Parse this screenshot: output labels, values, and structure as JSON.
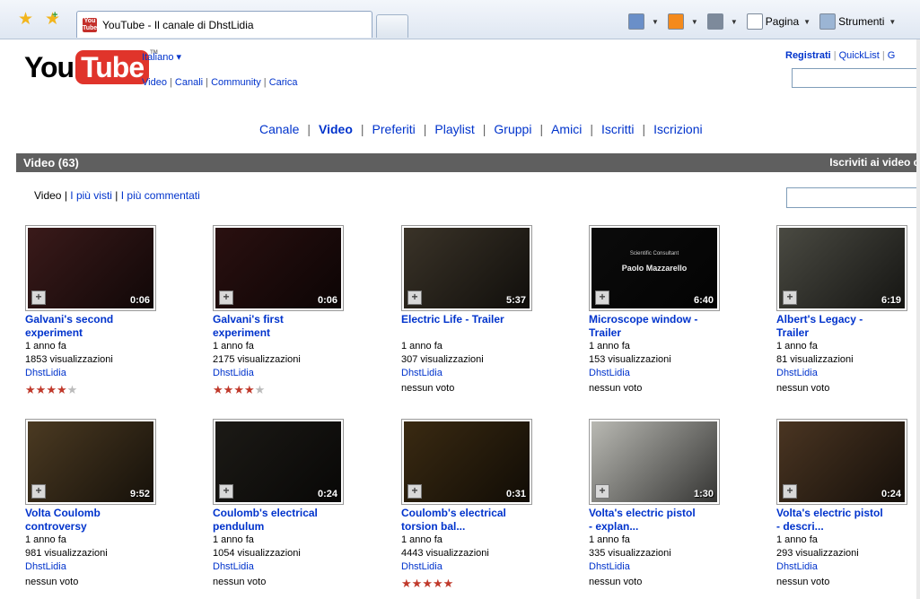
{
  "browser": {
    "tab_title": "YouTube - Il canale di DhstLidia",
    "favicon_text": "You Tube",
    "tools": [
      {
        "icon": "home-icon",
        "color": "#6a8fc8",
        "label": ""
      },
      {
        "icon": "rss-icon",
        "color": "#f48a1c",
        "label": ""
      },
      {
        "icon": "print-icon",
        "color": "#7d8a9b",
        "label": ""
      },
      {
        "icon": "page-icon",
        "color": "#ffffff",
        "label": "Pagina"
      },
      {
        "icon": "gear-icon",
        "color": "#9bb5d4",
        "label": "Strumenti"
      }
    ]
  },
  "header": {
    "logo_you": "You",
    "logo_tube": "Tube",
    "logo_tm": "TM",
    "language": "Italiano ▾",
    "top_links": [
      "Video",
      "Canali",
      "Community",
      "Carica"
    ],
    "register": "Registrati",
    "quicklist": "QuickList",
    "cut_link": "G"
  },
  "channel_nav": {
    "items": [
      "Canale",
      "Video",
      "Preferiti",
      "Playlist",
      "Gruppi",
      "Amici",
      "Iscritti",
      "Iscrizioni"
    ],
    "active": "Video"
  },
  "section": {
    "title": "Video (63)",
    "subscribe": "Iscriviti ai video d"
  },
  "sub_links": [
    "Video",
    "I più visti",
    "I più commentati"
  ],
  "videos": [
    {
      "title_1": "Galvani's second",
      "title_2": "experiment",
      "age": "1 anno fa",
      "views": "1853 visualizzazioni",
      "user": "DhstLidia",
      "duration": "0:06",
      "rating": 4,
      "rating_text": "",
      "bg": "#3a1a1a"
    },
    {
      "title_1": "Galvani's first",
      "title_2": "experiment",
      "age": "1 anno fa",
      "views": "2175 visualizzazioni",
      "user": "DhstLidia",
      "duration": "0:06",
      "rating": 4,
      "rating_text": "",
      "bg": "#2a1010"
    },
    {
      "title_1": "Electric Life - Trailer",
      "title_2": "",
      "age": "1 anno fa",
      "views": "307 visualizzazioni",
      "user": "DhstLidia",
      "duration": "5:37",
      "rating": 0,
      "rating_text": "nessun voto",
      "bg": "#3a3328"
    },
    {
      "title_1": "Microscope window -",
      "title_2": "Trailer",
      "age": "1 anno fa",
      "views": "153 visualizzazioni",
      "user": "DhstLidia",
      "duration": "6:40",
      "rating": 0,
      "rating_text": "nessun voto",
      "bg": "#0b0b0b",
      "caption_small": "Scientific Consultant",
      "caption_big": "Paolo Mazzarello"
    },
    {
      "title_1": "Albert's Legacy -",
      "title_2": "Trailer",
      "age": "1 anno fa",
      "views": "81 visualizzazioni",
      "user": "DhstLidia",
      "duration": "6:19",
      "rating": 0,
      "rating_text": "nessun voto",
      "bg": "#4a4a42"
    },
    {
      "title_1": "Volta Coulomb",
      "title_2": "controversy",
      "age": "1 anno fa",
      "views": "981 visualizzazioni",
      "user": "DhstLidia",
      "duration": "9:52",
      "rating": 0,
      "rating_text": "nessun voto",
      "bg": "#4b3a22"
    },
    {
      "title_1": "Coulomb's electrical",
      "title_2": "pendulum",
      "age": "1 anno fa",
      "views": "1054 visualizzazioni",
      "user": "DhstLidia",
      "duration": "0:24",
      "rating": 0,
      "rating_text": "nessun voto",
      "bg": "#1c1a16"
    },
    {
      "title_1": "Coulomb's electrical",
      "title_2": "torsion bal...",
      "age": "1 anno fa",
      "views": "4443 visualizzazioni",
      "user": "DhstLidia",
      "duration": "0:31",
      "rating": 5,
      "rating_text": "",
      "bg": "#3a2a12"
    },
    {
      "title_1": "Volta's electric pistol",
      "title_2": "- explan...",
      "age": "1 anno fa",
      "views": "335 visualizzazioni",
      "user": "DhstLidia",
      "duration": "1:30",
      "rating": 0,
      "rating_text": "nessun voto",
      "bg": "#b9b9b3"
    },
    {
      "title_1": "Volta's electric pistol",
      "title_2": "- descri...",
      "age": "1 anno fa",
      "views": "293 visualizzazioni",
      "user": "DhstLidia",
      "duration": "0:24",
      "rating": 0,
      "rating_text": "nessun voto",
      "bg": "#4a3522"
    }
  ]
}
